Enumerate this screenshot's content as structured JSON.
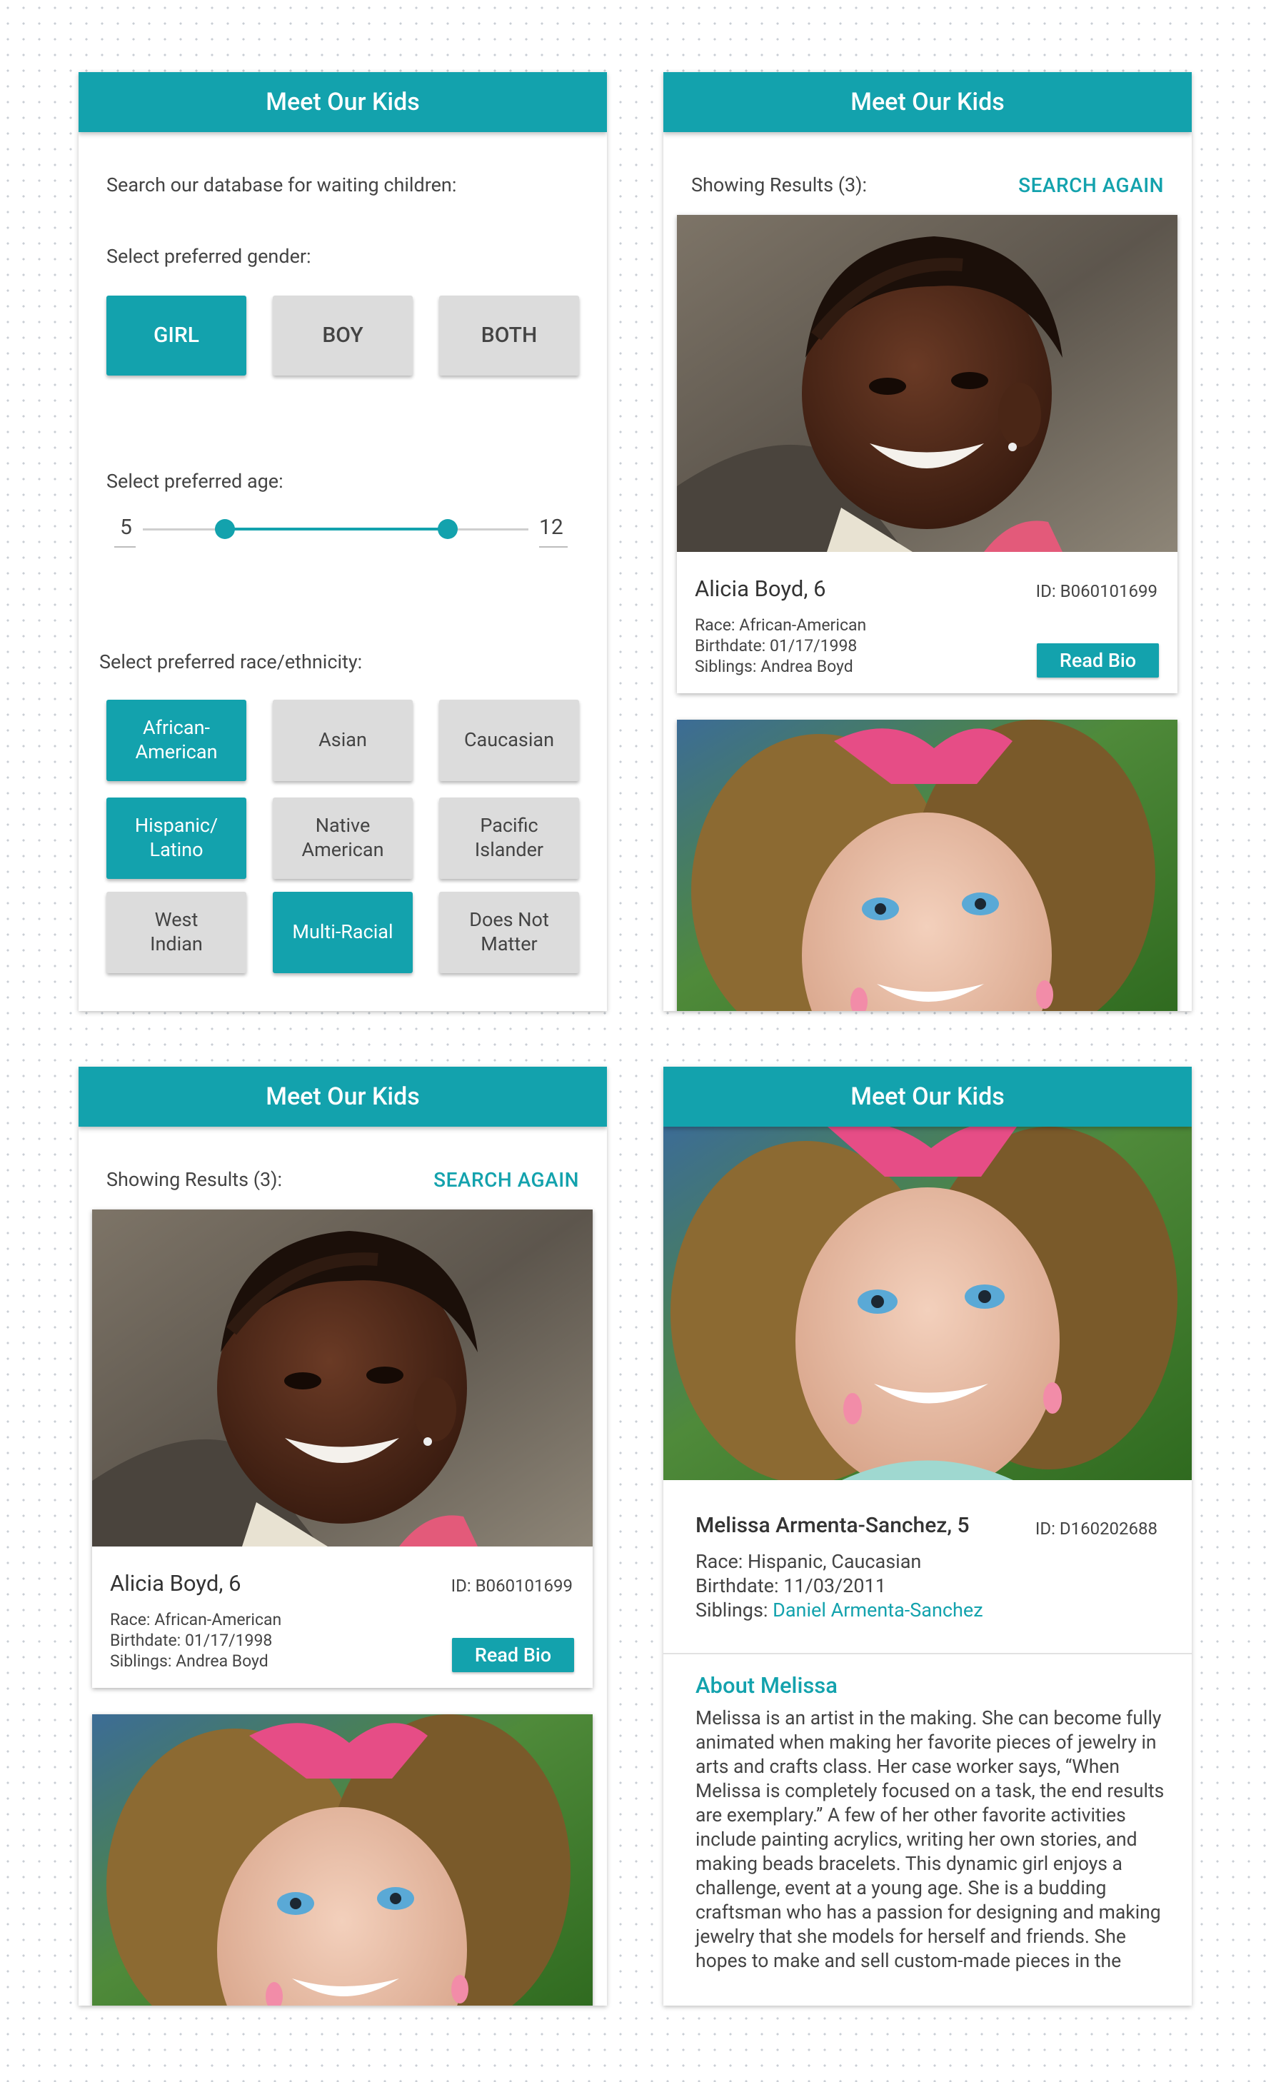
{
  "panels": {
    "header_title": "Meet Our Kids"
  },
  "search": {
    "intro": "Search our database for waiting children:",
    "gender_label": "Select preferred gender:",
    "gender_options": [
      "GIRL",
      "BOY",
      "BOTH"
    ],
    "gender_selected": "GIRL",
    "age_label": "Select preferred age:",
    "age_min": "5",
    "age_max": "12",
    "race_label": "Select preferred race/ethnicity:",
    "race_options": [
      {
        "label": "African-American",
        "selected": true
      },
      {
        "label": "Asian",
        "selected": false
      },
      {
        "label": "Caucasian",
        "selected": false
      },
      {
        "label": "Hispanic/ Latino",
        "selected": true
      },
      {
        "label": "Native American",
        "selected": false
      },
      {
        "label": "Pacific Islander",
        "selected": false
      },
      {
        "label": "West Indian",
        "selected": false
      },
      {
        "label": "Multi-Racial",
        "selected": true
      },
      {
        "label": "Does Not Matter",
        "selected": false
      }
    ]
  },
  "results": {
    "showing": "Showing Results (3):",
    "search_again": "SEARCH AGAIN",
    "read_bio": "Read Bio",
    "kids": [
      {
        "name": "Alicia Boyd, 6",
        "id": "ID: B060101699",
        "race": "Race: African-American",
        "birthdate": "Birthdate: 01/17/1998",
        "siblings": "Siblings: Andrea Boyd"
      }
    ]
  },
  "profile": {
    "name": "Melissa Armenta-Sanchez, 5",
    "id": "ID: D160202688",
    "race": "Race: Hispanic, Caucasian",
    "birthdate": "Birthdate: 11/03/2011",
    "siblings_label": "Siblings: ",
    "siblings_name": "Daniel Armenta-Sanchez",
    "about_title": "About Melissa",
    "about_text": "Melissa is an artist in the making. She can become fully animated when making her favorite pieces of jewelry in arts and crafts class. Her case worker says, “When Melissa is completely focused on a task, the end results are exemplary.” A few of her other favorite activities include painting acrylics, writing her own stories, and making beads bracelets. This dynamic girl enjoys a challenge, event at a young age. She is a budding craftsman who has a passion for designing and making jewelry that she models for herself and friends. She hopes to make and sell custom-made pieces in the"
  },
  "colors": {
    "accent": "#13a2ad",
    "button_off": "#dcdcdc"
  }
}
